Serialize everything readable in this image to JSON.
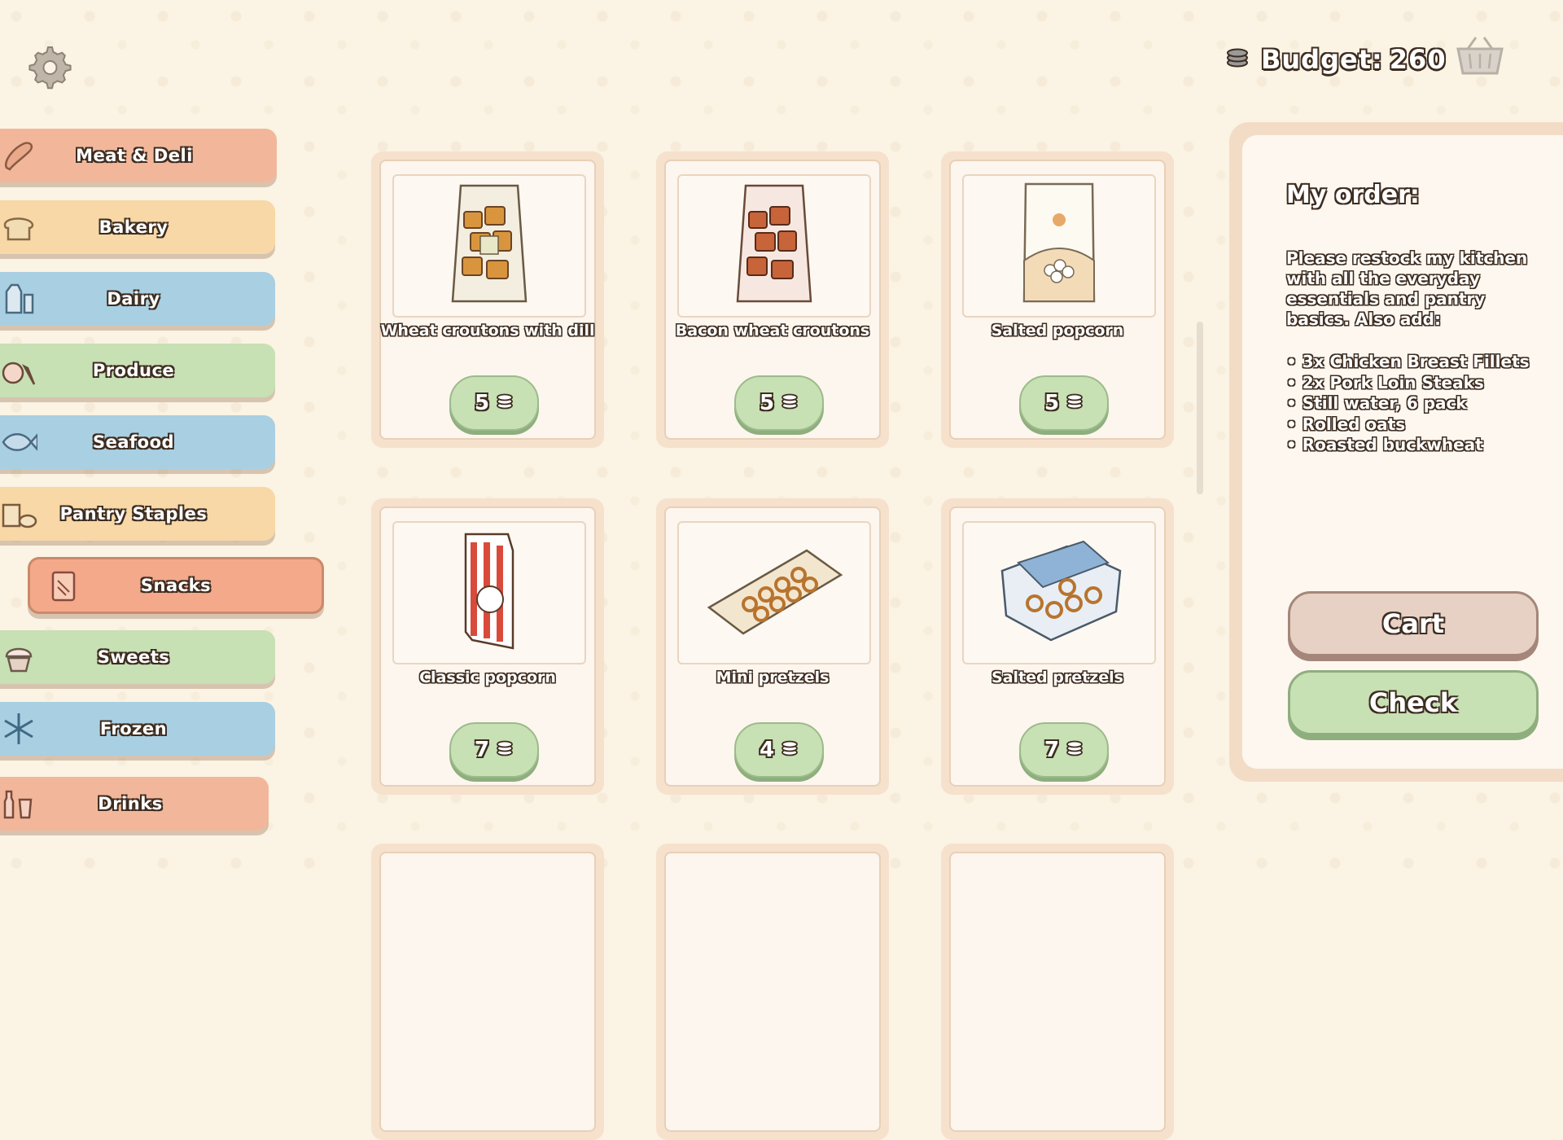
{
  "header": {
    "budget_label": "Budget:",
    "budget_value": "260",
    "icons": [
      "settings-gear-icon",
      "coins-icon",
      "shopping-basket-icon"
    ]
  },
  "sidebar": {
    "categories": [
      {
        "label": "Meat & Deli",
        "icon": "sausage-icon",
        "color": "#f2b79a"
      },
      {
        "label": "Bakery",
        "icon": "bread-icon",
        "color": "#f7d8a6"
      },
      {
        "label": "Dairy",
        "icon": "milk-carton-icon",
        "color": "#a9cfe2"
      },
      {
        "label": "Produce",
        "icon": "apple-carrot-icon",
        "color": "#c7e0b4"
      },
      {
        "label": "Seafood",
        "icon": "fish-icon",
        "color": "#a9cfe2"
      },
      {
        "label": "Pantry Staples",
        "icon": "pantry-jar-icon",
        "color": "#f7d8a6"
      },
      {
        "label": "Snacks",
        "icon": "snack-bag-icon",
        "color": "#f3a98a",
        "active": true
      },
      {
        "label": "Sweets",
        "icon": "cupcake-icon",
        "color": "#c7e0b4"
      },
      {
        "label": "Frozen",
        "icon": "snowflake-icon",
        "color": "#a9cfe2"
      },
      {
        "label": "Drinks",
        "icon": "bottles-icon",
        "color": "#f2b79a"
      }
    ]
  },
  "products": [
    {
      "name": "Wheat croutons with dill",
      "price": "5",
      "icon": "crouton-bag-icon"
    },
    {
      "name": "Bacon wheat croutons",
      "price": "5",
      "icon": "bacon-crouton-bag-icon"
    },
    {
      "name": "Salted popcorn",
      "price": "5",
      "icon": "popcorn-pouch-icon"
    },
    {
      "name": "Classic popcorn",
      "price": "7",
      "icon": "popcorn-bag-icon"
    },
    {
      "name": "Mini pretzels",
      "price": "4",
      "icon": "mini-pretzel-bag-icon"
    },
    {
      "name": "Salted pretzels",
      "price": "7",
      "icon": "pretzel-tub-icon"
    }
  ],
  "order": {
    "title": "My order:",
    "text": "Please restock my kitchen with all the everyday essentials and pantry basics. Also add:",
    "items": [
      "3x Chicken Breast Fillets",
      "2x Pork Loin Steaks",
      "Still water, 6 pack",
      "Rolled oats",
      "Roasted buckwheat"
    ],
    "cart_label": "Cart",
    "check_label": "Check"
  },
  "colors": {
    "background": "#fbf3e3",
    "outline": "#3d2c20",
    "green_button": "#c7e0b4"
  }
}
